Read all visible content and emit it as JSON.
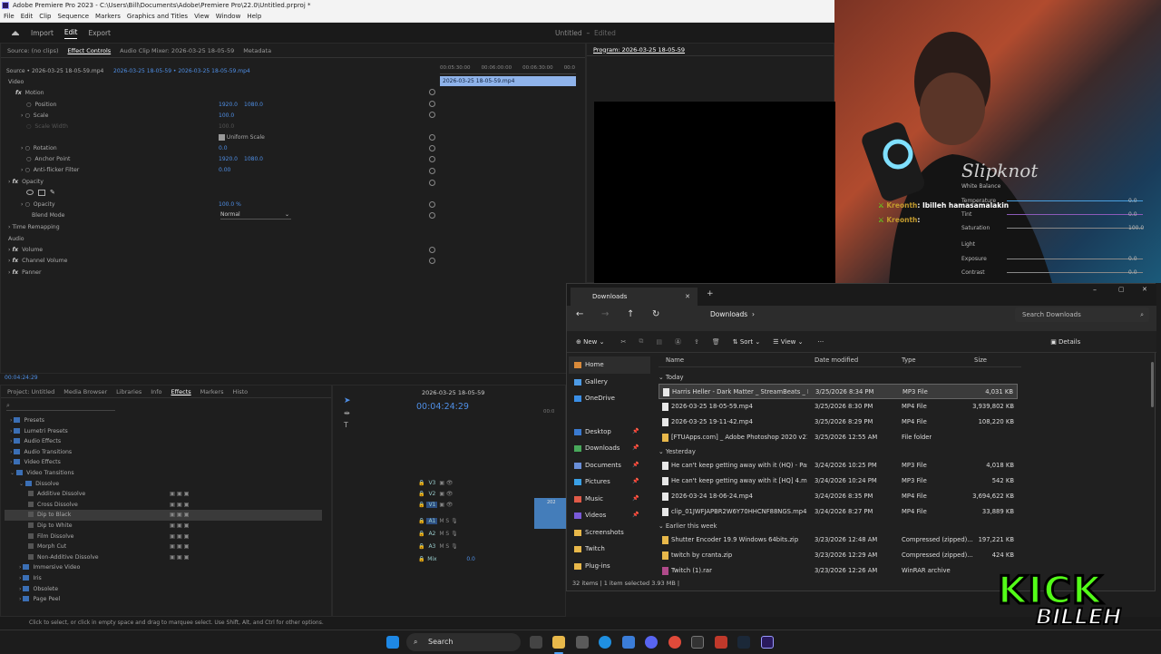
{
  "titlebar": {
    "title": "Adobe Premiere Pro 2023 - C:\\Users\\Bill\\Documents\\Adobe\\Premiere Pro\\22.0\\Untitled.prproj *"
  },
  "menu": [
    "File",
    "Edit",
    "Clip",
    "Sequence",
    "Markers",
    "Graphics and Titles",
    "View",
    "Window",
    "Help"
  ],
  "workspace": {
    "home": "home-icon",
    "import": "Import",
    "edit": "Edit",
    "export": "Export",
    "project": "Untitled",
    "status": "Edited"
  },
  "top_tabs": {
    "source": "Source: (no clips)",
    "effect_controls": "Effect Controls",
    "mixer": "Audio Clip Mixer: 2026-03-25 18-05-59",
    "metadata": "Metadata",
    "program": "Program: 2026-03-25 18-05-59"
  },
  "ec": {
    "source_line": "Source • 2026-03-25 18-05-59.mp4",
    "seq_line": "2026-03-25 18-05-59 • 2026-03-25 18-05-59.mp4",
    "ruler": [
      "00:05:30:00",
      "00:06:00:00",
      "00:06:30:00",
      "00:0"
    ],
    "clip": "2026-03-25 18-05-59.mp4",
    "video": "Video",
    "motion": "Motion",
    "position": "Position",
    "pos_x": "1920.0",
    "pos_y": "1080.0",
    "scale": "Scale",
    "scale_val": "100.0",
    "scale_width": "Scale Width",
    "scale_width_val": "100.0",
    "uniform": "Uniform Scale",
    "rotation": "Rotation",
    "rotation_val": "0.0",
    "anchor": "Anchor Point",
    "anc_x": "1920.0",
    "anc_y": "1080.0",
    "antiflicker": "Anti-flicker Filter",
    "antiflicker_val": "0.00",
    "opacity": "Opacity",
    "opacity_sub": "Opacity",
    "opacity_val": "100.0 %",
    "blend": "Blend Mode",
    "blend_val": "Normal",
    "time_remap": "Time Remapping",
    "audio": "Audio",
    "volume": "Volume",
    "channel_volume": "Channel Volume",
    "panner": "Panner",
    "timecode": "00:04:24:29"
  },
  "project_tabs": [
    "Project: Untitled",
    "Media Browser",
    "Libraries",
    "Info",
    "Effects",
    "Markers",
    "Histo"
  ],
  "effects_tree": [
    {
      "label": "Presets",
      "indent": 0
    },
    {
      "label": "Lumetri Presets",
      "indent": 0
    },
    {
      "label": "Audio Effects",
      "indent": 0
    },
    {
      "label": "Audio Transitions",
      "indent": 0
    },
    {
      "label": "Video Effects",
      "indent": 0
    },
    {
      "label": "Video Transitions",
      "indent": 0
    },
    {
      "label": "Dissolve",
      "indent": 1
    },
    {
      "label": "Additive Dissolve",
      "indent": 2
    },
    {
      "label": "Cross Dissolve",
      "indent": 2
    },
    {
      "label": "Dip to Black",
      "indent": 2
    },
    {
      "label": "Dip to White",
      "indent": 2
    },
    {
      "label": "Film Dissolve",
      "indent": 2
    },
    {
      "label": "Morph Cut",
      "indent": 2
    },
    {
      "label": "Non-Additive Dissolve",
      "indent": 2
    },
    {
      "label": "Immersive Video",
      "indent": 1
    },
    {
      "label": "Iris",
      "indent": 1
    },
    {
      "label": "Obsolete",
      "indent": 1
    },
    {
      "label": "Page Peel",
      "indent": 1
    }
  ],
  "timeline": {
    "seq": "2026-03-25 18-05-59",
    "timecode": "00:04:24:29",
    "ruler": "00:0",
    "tracks": [
      "V3",
      "V2",
      "V1",
      "A1",
      "A2",
      "A3",
      "Mix"
    ],
    "mix_val": "0.0",
    "clip_label": "202"
  },
  "status_bar": "Click to select, or click in empty space and drag to marquee select. Use Shift, Alt, and Ctrl for other options.",
  "chat": [
    {
      "user": "Kreonth",
      "msg": ": Ibilleh hamasamalakin"
    },
    {
      "user": "Kreonth",
      "msg": ":"
    }
  ],
  "lumetri": {
    "white_balance": "White Balance",
    "temperature": "Temperature",
    "tint": "Tint",
    "saturation": "Saturation",
    "light": "Light",
    "exposure": "Exposure",
    "contrast": "Contrast",
    "temp_val": "0.0",
    "tint_val": "0.0",
    "sat_val": "100.0",
    "exp_val": "0.0",
    "con_val": "0.0"
  },
  "explorer": {
    "tab": "Downloads",
    "path": "Downloads",
    "search": "Search Downloads",
    "toolbar": {
      "new": "New",
      "sort": "Sort",
      "view": "View",
      "details": "Details"
    },
    "sidebar": [
      {
        "label": "Home",
        "color": "#d98a3a"
      },
      {
        "label": "Gallery",
        "color": "#4d9be6"
      },
      {
        "label": "OneDrive",
        "color": "#3a8ee6"
      },
      {
        "label": "Desktop",
        "color": "#3a7ad0"
      },
      {
        "label": "Downloads",
        "color": "#48a85a"
      },
      {
        "label": "Documents",
        "color": "#6a8fd8"
      },
      {
        "label": "Pictures",
        "color": "#3aa0e6"
      },
      {
        "label": "Music",
        "color": "#e05a48"
      },
      {
        "label": "Videos",
        "color": "#7a5ad8"
      },
      {
        "label": "Screenshots",
        "color": "#e8b84a"
      },
      {
        "label": "Twitch",
        "color": "#e8b84a"
      },
      {
        "label": "Plug-ins",
        "color": "#e8b84a"
      }
    ],
    "columns": [
      "Name",
      "Date modified",
      "Type",
      "Size"
    ],
    "groups": [
      "Today",
      "Yesterday",
      "Earlier this week"
    ],
    "files": [
      {
        "name": "Harris Heller - Dark Matter _ StreamBeats _ Elec...",
        "date": "3/25/2026 8:34 PM",
        "type": "MP3 File",
        "size": "4,031 KB",
        "icon": "#e8e8e8",
        "group": 0
      },
      {
        "name": "2026-03-25 18-05-59.mp4",
        "date": "3/25/2026 8:30 PM",
        "type": "MP4 File",
        "size": "3,939,802 KB",
        "icon": "#e8e8e8",
        "group": 0
      },
      {
        "name": "2026-03-25 19-11-42.mp4",
        "date": "3/25/2026 8:29 PM",
        "type": "MP4 File",
        "size": "108,220 KB",
        "icon": "#e8e8e8",
        "group": 0
      },
      {
        "name": "[FTUApps.com] _ Adobe Photoshop 2020 v21.2....",
        "date": "3/25/2026 12:55 AM",
        "type": "File folder",
        "size": "",
        "icon": "#e8b84a",
        "group": 0
      },
      {
        "name": "He can't keep getting away with it (HQ) - Pase...",
        "date": "3/24/2026 10:25 PM",
        "type": "MP3 File",
        "size": "4,018 KB",
        "icon": "#e8e8e8",
        "group": 1
      },
      {
        "name": "He can't keep getting away with it [HQ] 4.mp3",
        "date": "3/24/2026 10:24 PM",
        "type": "MP3 File",
        "size": "542 KB",
        "icon": "#e8e8e8",
        "group": 1
      },
      {
        "name": "2026-03-24 18-06-24.mp4",
        "date": "3/24/2026 8:35 PM",
        "type": "MP4 File",
        "size": "3,694,622 KB",
        "icon": "#e8e8e8",
        "group": 1
      },
      {
        "name": "clip_01JWFJAPBR2W6Y70HHCNF88NGS.mp4",
        "date": "3/24/2026 8:27 PM",
        "type": "MP4 File",
        "size": "33,889 KB",
        "icon": "#e8e8e8",
        "group": 1
      },
      {
        "name": "Shutter Encoder 19.9 Windows 64bits.zip",
        "date": "3/23/2026 12:48 AM",
        "type": "Compressed (zipped)...",
        "size": "197,221 KB",
        "icon": "#e8b84a",
        "group": 2
      },
      {
        "name": "twitch by cranta.zip",
        "date": "3/23/2026 12:29 AM",
        "type": "Compressed (zipped)...",
        "size": "424 KB",
        "icon": "#e8b84a",
        "group": 2
      },
      {
        "name": "Twitch (1).rar",
        "date": "3/23/2026 12:26 AM",
        "type": "WinRAR archive",
        "size": "",
        "icon": "#b04a8a",
        "group": 2
      }
    ],
    "status": "32 items  |  1 item selected  3.93 MB  |"
  },
  "taskbar": {
    "search": "Search"
  },
  "kick": {
    "brand": "KICK",
    "name": "BILLEH"
  },
  "colors": {
    "accent": "#4f8fe6",
    "select": "#3d4f6e",
    "kick": "#53fc18"
  }
}
